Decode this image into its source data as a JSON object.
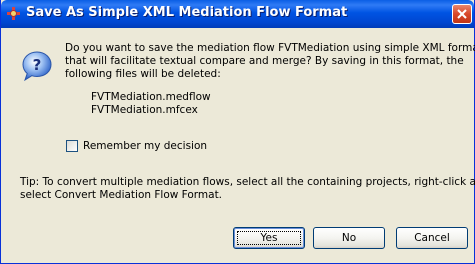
{
  "window": {
    "title": "Save As Simple XML Mediation Flow Format"
  },
  "dialog": {
    "message_lines": [
      "Do you want to save the mediation flow FVTMediation using simple XML format",
      "that will facilitate textual compare and merge? By saving in this format, the",
      "following files will be deleted:"
    ],
    "files": [
      "FVTMediation.medflow",
      "FVTMediation.mfcex"
    ],
    "remember_label": "Remember my decision",
    "remember_checked": false,
    "tip_lines": [
      "Tip: To convert multiple mediation flows, select all the containing projects, right-click and",
      "select Convert Mediation Flow Format."
    ]
  },
  "buttons": {
    "yes": "Yes",
    "no": "No",
    "cancel": "Cancel"
  },
  "icons": {
    "title": "app-icon",
    "close": "close-icon",
    "message": "question-icon"
  },
  "colors": {
    "titlebar": "#0054e3",
    "dialog_bg": "#ece9d8",
    "close_button": "#d8482a"
  }
}
